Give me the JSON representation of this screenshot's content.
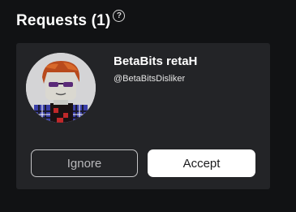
{
  "header": {
    "title": "Requests (1)",
    "help_icon": "question-circle-icon"
  },
  "request": {
    "display_name": "BetaBits retaH",
    "username": "@BetaBitsDisliker",
    "avatar_icon": "user-avatar",
    "ignore_label": "Ignore",
    "accept_label": "Accept"
  },
  "colors": {
    "background": "#111214",
    "card": "#232427",
    "accept_bg": "#ffffff",
    "ignore_border": "#c4c4c6"
  }
}
